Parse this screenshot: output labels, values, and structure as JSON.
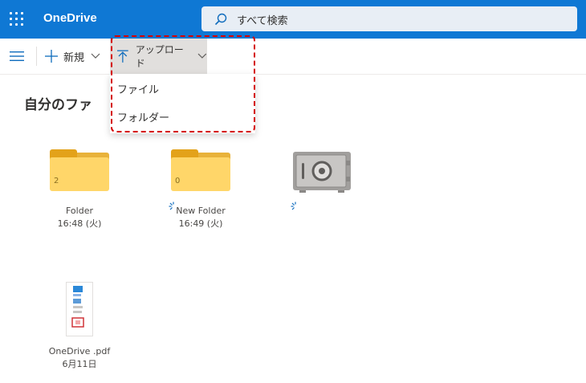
{
  "header": {
    "brand": "OneDrive",
    "search_placeholder": "すべて検索"
  },
  "toolbar": {
    "new_label": "新規",
    "upload_label": "アップロード"
  },
  "upload_menu": {
    "items": [
      {
        "label": "ファイル"
      },
      {
        "label": "フォルダー"
      }
    ]
  },
  "page": {
    "title": "自分のファ"
  },
  "items": [
    {
      "type": "folder",
      "name": "Folder",
      "count": "2",
      "date": "16:48 (火)"
    },
    {
      "type": "folder",
      "name": "New Folder",
      "count": "0",
      "date": "16:49 (火)"
    },
    {
      "type": "vault",
      "name": "",
      "date": ""
    },
    {
      "type": "pdf",
      "name": "OneDrive .pdf",
      "date": "6月11日"
    }
  ],
  "colors": {
    "header_bg": "#0f78d4",
    "highlight_border": "#d40000",
    "folder": "#ffd669",
    "accent": "#0f78d4"
  }
}
